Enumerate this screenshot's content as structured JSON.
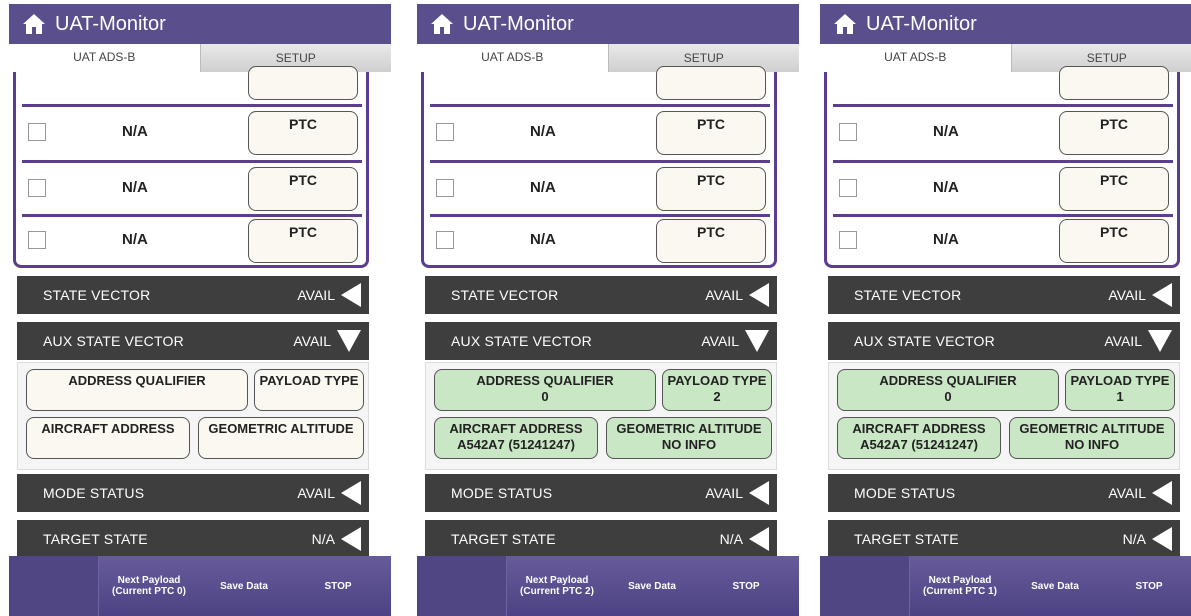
{
  "colors": {
    "titlebar": "#5a4f8c",
    "accent_purple": "#5b3e8f",
    "section_bg": "#3e3e3e",
    "field_green": "#c9e7c4",
    "field_plain": "#fbf8f2"
  },
  "panels": [
    {
      "app_title": "UAT-Monitor",
      "home_icon": "home-icon",
      "tabs": [
        {
          "label": "UAT ADS-B"
        },
        {
          "label": "SETUP"
        }
      ],
      "rows": [
        {
          "value": "N/A",
          "button": "PTC"
        },
        {
          "value": "N/A",
          "button": "PTC"
        },
        {
          "value": "N/A",
          "button": "PTC"
        }
      ],
      "sections": {
        "state_vector": {
          "label": "STATE VECTOR",
          "status": "AVAIL"
        },
        "aux_state_vector": {
          "label": "AUX STATE VECTOR",
          "status": "AVAIL"
        },
        "mode_status": {
          "label": "MODE STATUS",
          "status": "AVAIL"
        },
        "target_state": {
          "label": "TARGET STATE",
          "status": "N/A"
        }
      },
      "aux_fields": {
        "address_qualifier": {
          "label": "ADDRESS QUALIFIER",
          "value": ""
        },
        "payload_type": {
          "label": "PAYLOAD TYPE",
          "value": ""
        },
        "aircraft_address": {
          "label": "AIRCRAFT ADDRESS",
          "value": ""
        },
        "geometric_altitude": {
          "label": "GEOMETRIC ALTITUDE",
          "value": ""
        }
      },
      "aux_fields_filled": false,
      "bottom": {
        "next_line1": "Next Payload",
        "next_line2": "(Current PTC 0)",
        "save": "Save Data",
        "stop": "STOP"
      }
    },
    {
      "app_title": "UAT-Monitor",
      "home_icon": "home-icon",
      "tabs": [
        {
          "label": "UAT ADS-B"
        },
        {
          "label": "SETUP"
        }
      ],
      "rows": [
        {
          "value": "N/A",
          "button": "PTC"
        },
        {
          "value": "N/A",
          "button": "PTC"
        },
        {
          "value": "N/A",
          "button": "PTC"
        }
      ],
      "sections": {
        "state_vector": {
          "label": "STATE VECTOR",
          "status": "AVAIL"
        },
        "aux_state_vector": {
          "label": "AUX STATE VECTOR",
          "status": "AVAIL"
        },
        "mode_status": {
          "label": "MODE STATUS",
          "status": "AVAIL"
        },
        "target_state": {
          "label": "TARGET STATE",
          "status": "N/A"
        }
      },
      "aux_fields": {
        "address_qualifier": {
          "label": "ADDRESS QUALIFIER",
          "value": "0"
        },
        "payload_type": {
          "label": "PAYLOAD TYPE",
          "value": "2"
        },
        "aircraft_address": {
          "label": "AIRCRAFT ADDRESS",
          "value": "A542A7 (51241247)"
        },
        "geometric_altitude": {
          "label": "GEOMETRIC ALTITUDE",
          "value": "NO INFO"
        }
      },
      "aux_fields_filled": true,
      "bottom": {
        "next_line1": "Next Payload",
        "next_line2": "(Current PTC 2)",
        "save": "Save Data",
        "stop": "STOP"
      }
    },
    {
      "app_title": "UAT-Monitor",
      "home_icon": "home-icon",
      "tabs": [
        {
          "label": "UAT ADS-B"
        },
        {
          "label": "SETUP"
        }
      ],
      "rows": [
        {
          "value": "N/A",
          "button": "PTC"
        },
        {
          "value": "N/A",
          "button": "PTC"
        },
        {
          "value": "N/A",
          "button": "PTC"
        }
      ],
      "sections": {
        "state_vector": {
          "label": "STATE VECTOR",
          "status": "AVAIL"
        },
        "aux_state_vector": {
          "label": "AUX STATE VECTOR",
          "status": "AVAIL"
        },
        "mode_status": {
          "label": "MODE STATUS",
          "status": "AVAIL"
        },
        "target_state": {
          "label": "TARGET STATE",
          "status": "N/A"
        }
      },
      "aux_fields": {
        "address_qualifier": {
          "label": "ADDRESS QUALIFIER",
          "value": "0"
        },
        "payload_type": {
          "label": "PAYLOAD TYPE",
          "value": "1"
        },
        "aircraft_address": {
          "label": "AIRCRAFT ADDRESS",
          "value": "A542A7 (51241247)"
        },
        "geometric_altitude": {
          "label": "GEOMETRIC ALTITUDE",
          "value": "NO INFO"
        }
      },
      "aux_fields_filled": true,
      "bottom": {
        "next_line1": "Next Payload",
        "next_line2": "(Current PTC 1)",
        "save": "Save Data",
        "stop": "STOP"
      }
    }
  ]
}
